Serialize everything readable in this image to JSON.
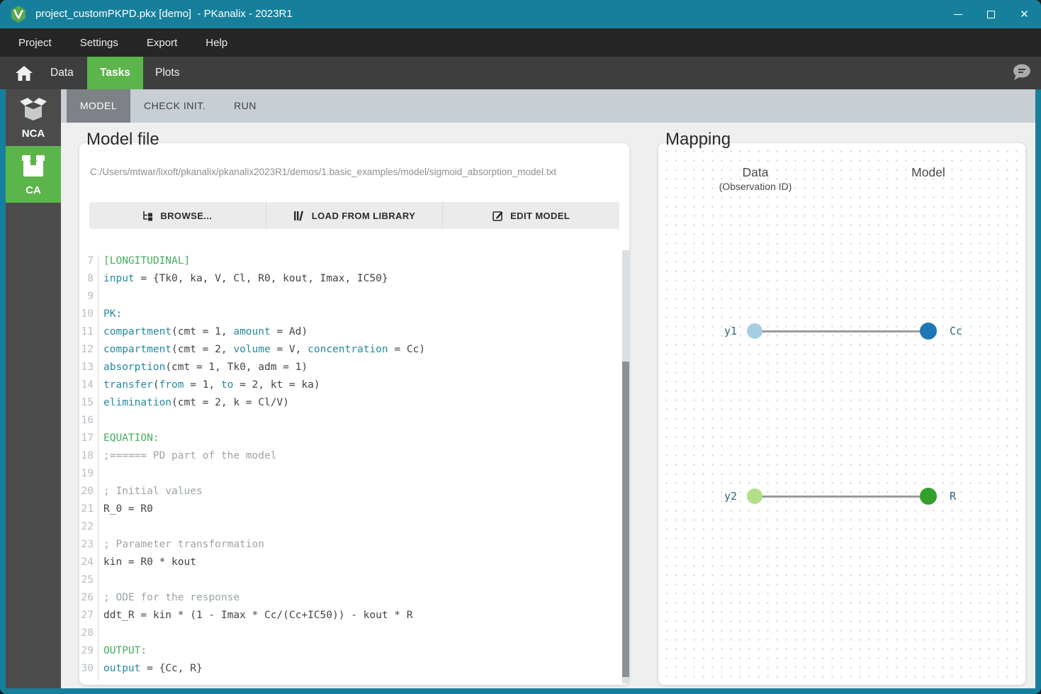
{
  "window": {
    "title": "project_customPKPD.pkx [demo]  - PKanalix - 2023R1"
  },
  "menu": {
    "items": [
      "Project",
      "Settings",
      "Export",
      "Help"
    ]
  },
  "nav": {
    "tabs": [
      {
        "label": "Data"
      },
      {
        "label": "Tasks",
        "active": true
      },
      {
        "label": "Plots"
      }
    ]
  },
  "sidebar": {
    "items": [
      {
        "label": "NCA"
      },
      {
        "label": "CA",
        "active": true
      }
    ]
  },
  "subtabs": [
    {
      "label": "MODEL",
      "active": true
    },
    {
      "label": "CHECK INIT."
    },
    {
      "label": "RUN"
    }
  ],
  "model_file": {
    "heading": "Model file",
    "path": "C:/Users/mtwar/lixoft/pkanalix/pkanalix2023R1/demos/1.basic_examples/model/sigmoid_absorption_model.txt",
    "buttons": [
      {
        "label": "BROWSE...",
        "icon": "browse-icon"
      },
      {
        "label": "LOAD FROM LIBRARY",
        "icon": "library-icon"
      },
      {
        "label": "EDIT MODEL",
        "icon": "edit-icon"
      }
    ],
    "code": [
      {
        "n": 7,
        "seg": [
          [
            "[LONGITUDINAL]",
            "sec"
          ]
        ]
      },
      {
        "n": 8,
        "seg": [
          [
            "input",
            "kw"
          ],
          [
            " = {Tk0, ka, V, Cl, R0, kout, Imax, IC50}",
            "txt"
          ]
        ]
      },
      {
        "n": 9,
        "seg": []
      },
      {
        "n": 10,
        "seg": [
          [
            "PK:",
            "kw"
          ]
        ]
      },
      {
        "n": 11,
        "seg": [
          [
            "compartment",
            "kw"
          ],
          [
            "(cmt = 1, ",
            "txt"
          ],
          [
            "amount",
            "kw"
          ],
          [
            " = Ad)",
            "txt"
          ]
        ]
      },
      {
        "n": 12,
        "seg": [
          [
            "compartment",
            "kw"
          ],
          [
            "(cmt = 2, ",
            "txt"
          ],
          [
            "volume",
            "kw"
          ],
          [
            " = V, ",
            "txt"
          ],
          [
            "concentration",
            "kw"
          ],
          [
            " = Cc)",
            "txt"
          ]
        ]
      },
      {
        "n": 13,
        "seg": [
          [
            "absorption",
            "kw"
          ],
          [
            "(cmt = 1, Tk0, adm = 1)",
            "txt"
          ]
        ]
      },
      {
        "n": 14,
        "seg": [
          [
            "transfer",
            "kw"
          ],
          [
            "(",
            "txt"
          ],
          [
            "from",
            "kw"
          ],
          [
            " = 1, ",
            "txt"
          ],
          [
            "to",
            "kw"
          ],
          [
            " = 2, kt = ka)",
            "txt"
          ]
        ]
      },
      {
        "n": 15,
        "seg": [
          [
            "elimination",
            "kw"
          ],
          [
            "(cmt = 2, k = Cl/V)",
            "txt"
          ]
        ]
      },
      {
        "n": 16,
        "seg": []
      },
      {
        "n": 17,
        "seg": [
          [
            "EQUATION:",
            "sec"
          ]
        ]
      },
      {
        "n": 18,
        "seg": [
          [
            ";====== PD part of the model",
            "com"
          ]
        ]
      },
      {
        "n": 19,
        "seg": []
      },
      {
        "n": 20,
        "seg": [
          [
            "; Initial values",
            "com"
          ]
        ]
      },
      {
        "n": 21,
        "seg": [
          [
            "R_0 = R0",
            "txt"
          ]
        ]
      },
      {
        "n": 22,
        "seg": []
      },
      {
        "n": 23,
        "seg": [
          [
            "; Parameter transformation",
            "com"
          ]
        ]
      },
      {
        "n": 24,
        "seg": [
          [
            "kin = R0 * kout",
            "txt"
          ]
        ]
      },
      {
        "n": 25,
        "seg": []
      },
      {
        "n": 26,
        "seg": [
          [
            "; ODE for the response",
            "com"
          ]
        ]
      },
      {
        "n": 27,
        "seg": [
          [
            "ddt_R = kin * (1 - Imax * Cc/(Cc+IC50)) - kout * R",
            "txt"
          ]
        ]
      },
      {
        "n": 28,
        "seg": []
      },
      {
        "n": 29,
        "seg": [
          [
            "OUTPUT:",
            "sec"
          ]
        ]
      },
      {
        "n": 30,
        "seg": [
          [
            "output",
            "kw"
          ],
          [
            " = {Cc, R}",
            "txt"
          ]
        ]
      }
    ]
  },
  "mapping": {
    "heading": "Mapping",
    "data_header": "Data",
    "data_subheader": "(Observation ID)",
    "model_header": "Model",
    "rows": [
      {
        "data_label": "y1",
        "model_label": "Cc",
        "data_color": "#A6CEE3",
        "model_color": "#1F78B4"
      },
      {
        "data_label": "y2",
        "model_label": "R",
        "data_color": "#B2DF8A",
        "model_color": "#33A02C"
      }
    ]
  },
  "colors": {
    "titlebar_teal": "#16809C",
    "accent_green": "#5CB54B",
    "keyword_teal": "#2589A0",
    "section_green": "#45AD5F",
    "connector_gray": "#9B9B9B"
  }
}
